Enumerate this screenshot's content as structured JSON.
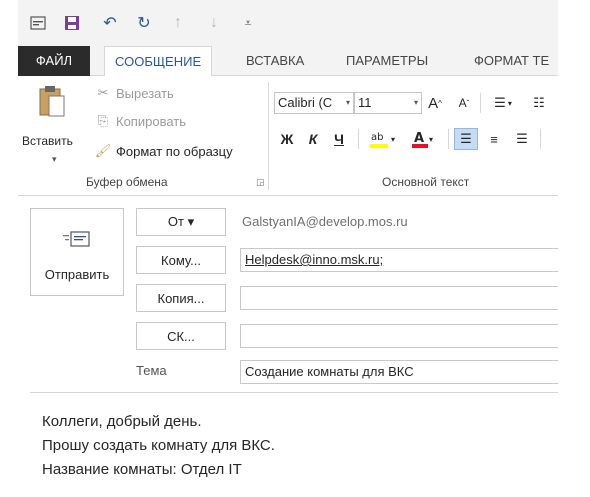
{
  "qat": {
    "items": [
      "window-icon",
      "save-icon",
      "undo-icon",
      "redo-icon",
      "up-icon",
      "down-icon",
      "customize-icon"
    ]
  },
  "tabs": [
    {
      "label": "ФАЙЛ"
    },
    {
      "label": "СООБЩЕНИЕ"
    },
    {
      "label": "ВСТАВКА"
    },
    {
      "label": "ПАРАМЕТРЫ"
    },
    {
      "label": "ФОРМАТ ТЕ"
    }
  ],
  "ribbon": {
    "clipboard": {
      "paste_label": "Вставить",
      "cut_label": "Вырезать",
      "copy_label": "Копировать",
      "format_painter_label": "Формат по образцу",
      "group_label": "Буфер обмена"
    },
    "basic_text": {
      "font_name": "Calibri (С",
      "font_size": "11",
      "grow_font": "A",
      "shrink_font": "A",
      "bold": "Ж",
      "italic": "К",
      "underline": "Ч",
      "group_label": "Основной текст"
    }
  },
  "compose": {
    "send_label": "Отправить",
    "from_button": "От ▾",
    "from_value": "GalstyanIA@develop.mos.ru",
    "to_button": "Кому...",
    "to_value": "Helpdesk@inno.msk.ru;",
    "cc_button": "Копия...",
    "cc_value": "",
    "bcc_button": "СК...",
    "bcc_value": "",
    "subject_label": "Тема",
    "subject_value": "Создание комнаты для ВКС"
  },
  "body": {
    "lines": [
      "Коллеги, добрый день.",
      "Прошу создать комнату для ВКС.",
      "Название комнаты: Отдел IT"
    ]
  },
  "colors": {
    "accent": "#2b579a",
    "file_tab_bg": "#2b2b2b",
    "highlight": "#ffff00",
    "font_color": "#e81123"
  }
}
